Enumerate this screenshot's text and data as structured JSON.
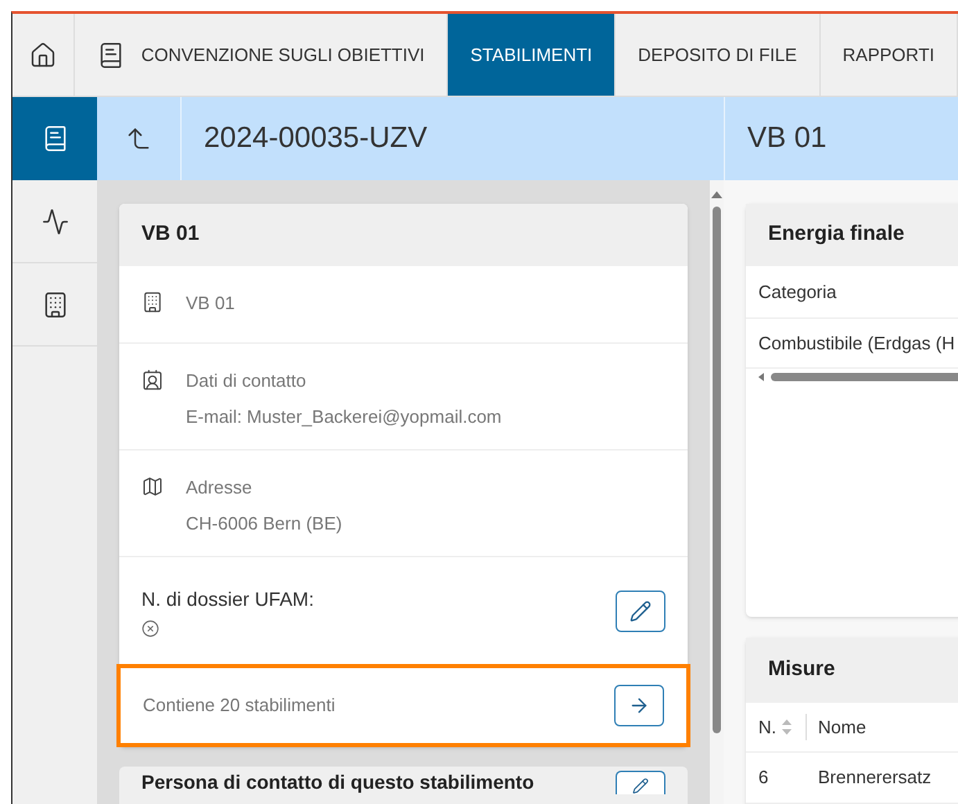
{
  "top_nav": {
    "tabs": [
      {
        "label": "CONVENZIONE SUGLI OBIETTIVI",
        "selected": false
      },
      {
        "label": "STABILIMENTI",
        "selected": true
      },
      {
        "label": "DEPOSITO DI FILE",
        "selected": false
      },
      {
        "label": "RAPPORTI",
        "selected": false
      }
    ]
  },
  "header": {
    "title": "2024-00035-UZV",
    "subtitle": "VB 01"
  },
  "sidebar": {
    "items": [
      {
        "selected": true
      },
      {
        "selected": false
      },
      {
        "selected": false
      }
    ]
  },
  "site_card": {
    "title": "VB 01",
    "rows": [
      {
        "kind": "info",
        "lines": [
          "VB 01"
        ]
      },
      {
        "kind": "info",
        "lines": [
          "Dati di contatto",
          "E-mail: Muster_Backerei@yopmail.com"
        ]
      },
      {
        "kind": "info",
        "lines": [
          "Adresse",
          "CH-6006 Bern (BE)"
        ]
      },
      {
        "kind": "edit",
        "label": "N. di dossier UFAM:"
      },
      {
        "kind": "link",
        "label": "Contiene 20 stabilimenti",
        "highlighted": true
      }
    ]
  },
  "contact_card": {
    "title": "Persona di contatto di questo stabilimento"
  },
  "energy_card": {
    "title": "Energia finale",
    "columns": [
      "Categoria"
    ],
    "rows": [
      [
        "Combustibile (Erdgas (H"
      ]
    ]
  },
  "measures_card": {
    "title": "Misure",
    "columns": [
      {
        "label": "N.",
        "sortable": true
      },
      {
        "label": "Nome",
        "sortable": false
      }
    ],
    "rows": [
      [
        "6",
        "Brennerersatz"
      ]
    ]
  }
}
